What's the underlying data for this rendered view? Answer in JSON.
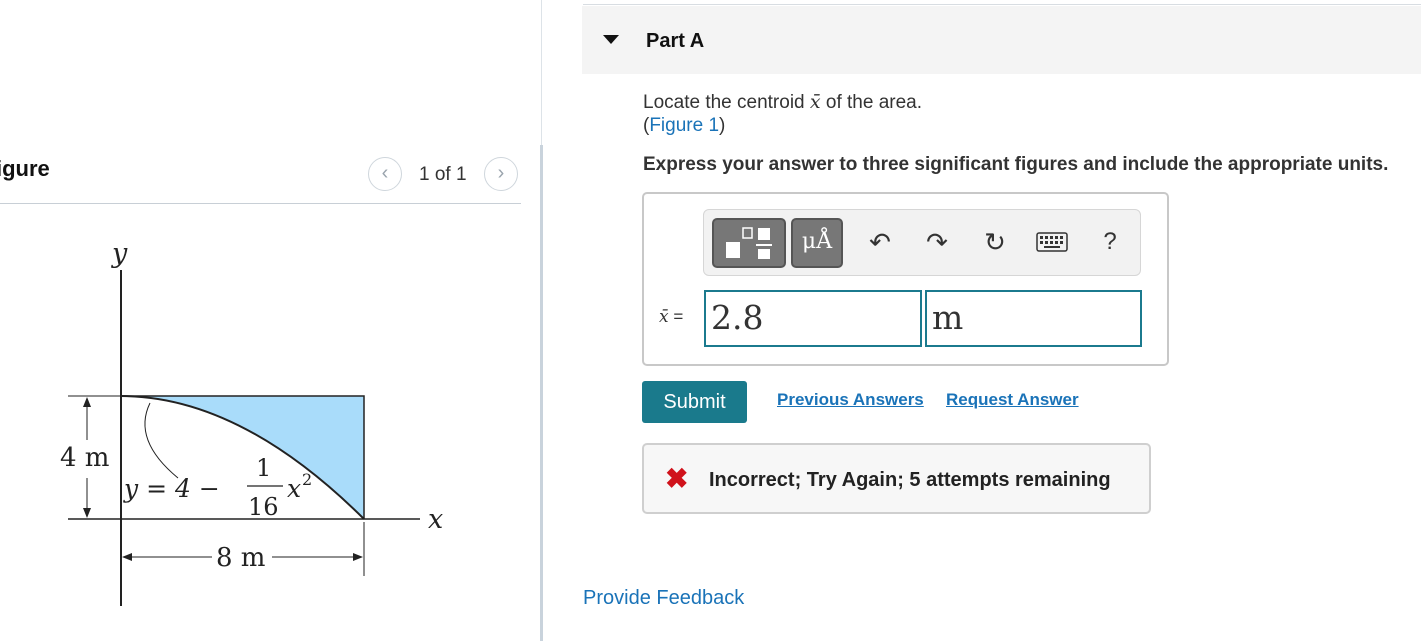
{
  "figure_panel": {
    "title": "igure",
    "pager_prev_icon": "chevron-left-icon",
    "pager_next_icon": "chevron-right-icon",
    "pager_count": "1 of 1",
    "figure": {
      "y_axis_label": "y",
      "x_axis_label": "x",
      "height_dim": "4 m",
      "width_dim": "8 m",
      "equation_lhs": "y = 4 −",
      "fraction_numerator": "1",
      "fraction_denominator": "16",
      "equation_var": "x",
      "equation_exp": "2",
      "fill_color": "#a9dcfa"
    }
  },
  "part": {
    "caret_icon": "caret-down-icon",
    "title": "Part A"
  },
  "question": {
    "text_before": "Locate the centroid ",
    "variable": "x̄",
    "text_after": " of the area.",
    "figure_link_open": "(",
    "figure_link": "Figure 1",
    "figure_link_close": ")",
    "instructions": "Express your answer to three significant figures and include the appropriate units."
  },
  "toolbar": {
    "templates_icon": "templates-icon",
    "units_label": "μÅ",
    "undo_icon": "undo-icon",
    "redo_icon": "redo-icon",
    "reset_icon": "reset-icon",
    "keyboard_icon": "keyboard-icon",
    "help_label": "?"
  },
  "answer": {
    "variable_label": "x̄",
    "equals": "=",
    "value": "2.8",
    "units": "m"
  },
  "actions": {
    "submit": "Submit",
    "previous_answers": "Previous Answers",
    "request_answer": "Request Answer"
  },
  "feedback": {
    "status_icon": "incorrect-x-icon",
    "message": "Incorrect; Try Again; 5 attempts remaining"
  },
  "footer": {
    "provide_feedback": "Provide Feedback"
  },
  "colors": {
    "accent_teal": "#1a7a8c",
    "link_blue": "#1a73b8",
    "error_red": "#d0121b"
  }
}
